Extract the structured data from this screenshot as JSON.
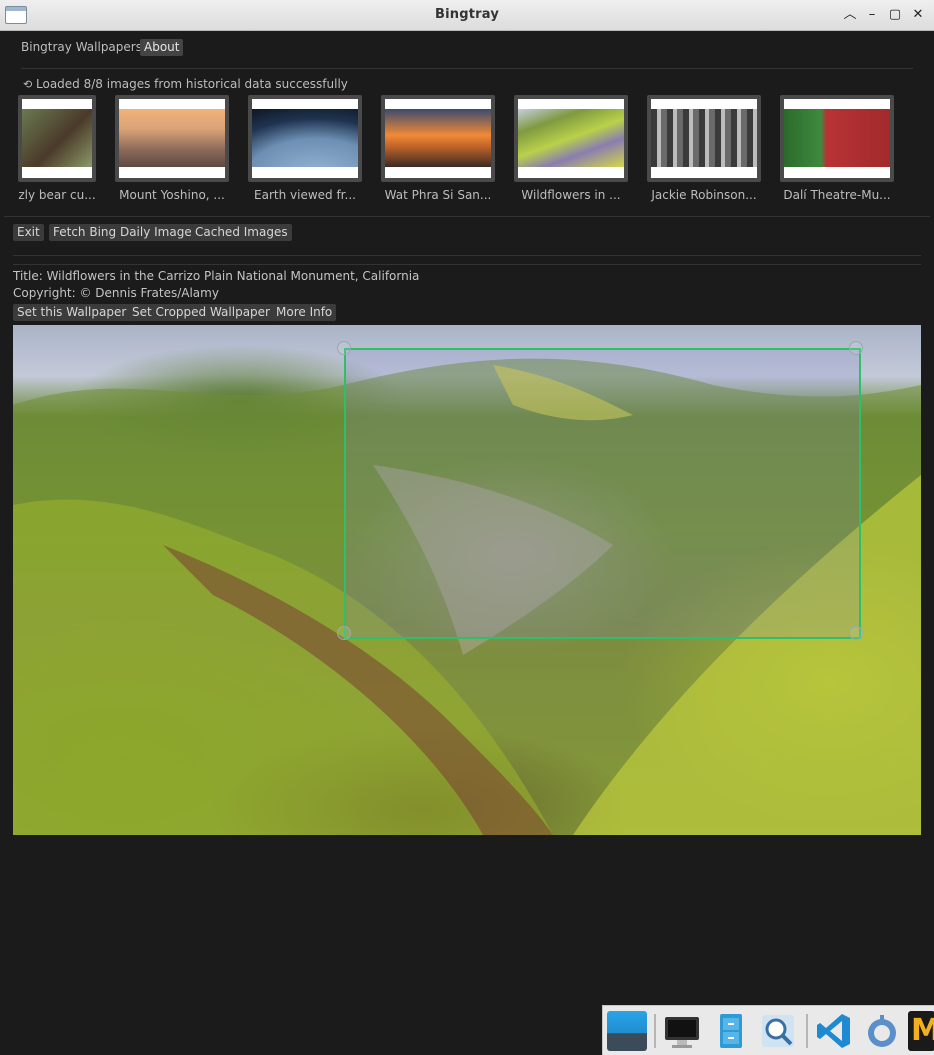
{
  "window": {
    "title": "Bingtray"
  },
  "menu": {
    "tabs": [
      "Bingtray Wallpapers",
      "About"
    ]
  },
  "status": {
    "icon": "refresh-icon",
    "text": "Loaded 8/8 images from historical data successfully"
  },
  "thumbnails": [
    {
      "caption": "zly bear cu...",
      "colors": [
        "#6a7a52",
        "#4b3a2a"
      ]
    },
    {
      "caption": "Mount Yoshino, ...",
      "colors": [
        "#d9a276",
        "#8d6a5a"
      ]
    },
    {
      "caption": "Earth viewed fr...",
      "colors": [
        "#0d1420",
        "#6d8fb3"
      ]
    },
    {
      "caption": "Wat Phra Si San...",
      "colors": [
        "#f08a35",
        "#3a2a24"
      ]
    },
    {
      "caption": "Wildflowers in ...",
      "colors": [
        "#b9d14a",
        "#8a7db0"
      ]
    },
    {
      "caption": "Jackie Robinson...",
      "colors": [
        "#3a3a3a",
        "#bdbdbd"
      ]
    },
    {
      "caption": "Dalí Theatre-Mu...",
      "colors": [
        "#2c6a2c",
        "#b83235"
      ]
    }
  ],
  "actions": {
    "exit": "Exit",
    "fetch": "Fetch Bing Daily Image",
    "cached": "Cached Images"
  },
  "image_info": {
    "title": "Title: Wildflowers in the Carrizo Plain National Monument, California",
    "copyright": "Copyright: © Dennis Frates/Alamy"
  },
  "wallpaper_actions": {
    "set": "Set this Wallpaper",
    "set_cropped": "Set Cropped Wallpaper",
    "more_info": "More Info"
  },
  "taskbar": {
    "icons": [
      "show-desktop-icon",
      "monitor-icon",
      "file-cabinet-icon",
      "search-folder-icon",
      "vscode-icon",
      "mascot-icon",
      "app-m-icon"
    ]
  },
  "colors": {
    "crop_border": "#2fbf6a",
    "background": "#1b1b1b",
    "button_bg": "#3b3b3b"
  }
}
